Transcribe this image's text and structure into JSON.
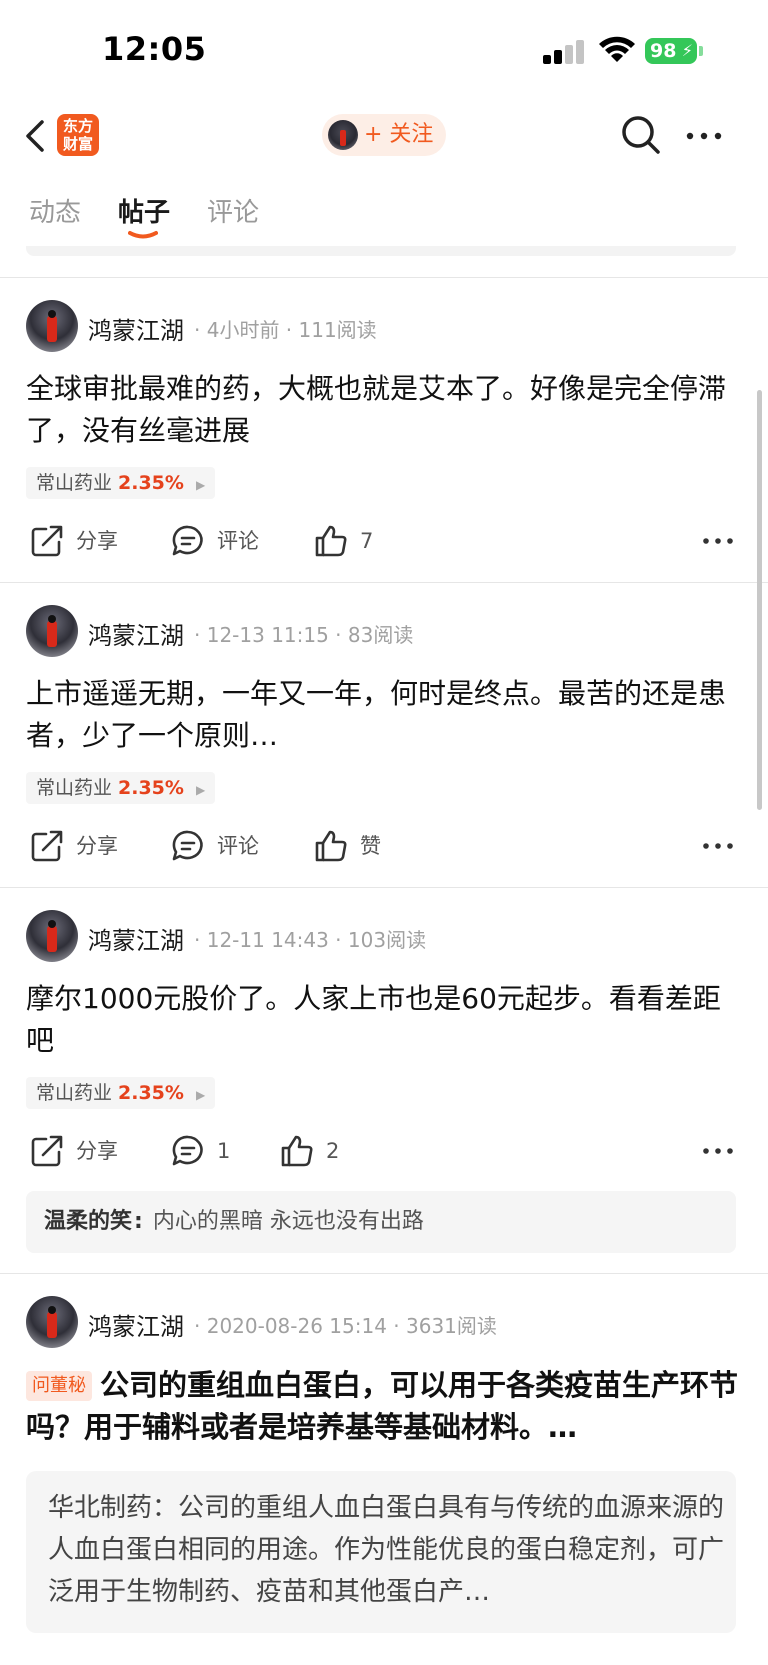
{
  "status_bar": {
    "time": "12:05",
    "battery": "98"
  },
  "nav": {
    "logo_line1": "东方",
    "logo_line2": "财富",
    "follow_label": "+ 关注"
  },
  "tabs": [
    {
      "label": "动态"
    },
    {
      "label": "帖子"
    },
    {
      "label": "评论"
    }
  ],
  "posts": [
    {
      "author": "鸿蒙江湖",
      "meta": "· 4小时前 · 111阅读",
      "text": "全球审批最难的药，大概也就是艾本了。好像是完全停滞了，没有丝毫进展",
      "stock_name": "常山药业",
      "stock_pct": "2.35%",
      "share_label": "分享",
      "comment_label": "评论",
      "like_label": "7"
    },
    {
      "author": "鸿蒙江湖",
      "meta": "· 12-13 11:15 · 83阅读",
      "text": "上市遥遥无期，一年又一年，何时是终点。最苦的还是患者，少了一个原则…",
      "stock_name": "常山药业",
      "stock_pct": "2.35%",
      "share_label": "分享",
      "comment_label": "评论",
      "like_label": "赞"
    },
    {
      "author": "鸿蒙江湖",
      "meta": "· 12-11 14:43 · 103阅读",
      "text": "摩尔1000元股价了。人家上市也是60元起步。看看差距吧",
      "stock_name": "常山药业",
      "stock_pct": "2.35%",
      "share_label": "分享",
      "comment_label": "1",
      "like_label": "2",
      "reply_user": "温柔的笑",
      "reply_text": "内心的黑暗 永远也没有出路"
    },
    {
      "author": "鸿蒙江湖",
      "meta": "· 2020-08-26 15:14 · 3631阅读",
      "badge": "问董秘",
      "title": "公司的重组血白蛋白，可以用于各类疫苗生产环节吗？用于辅料或者是培养基等基础材料。…",
      "answer": "华北制药：公司的重组人血白蛋白具有与传统的血源来源的人血白蛋白相同的用途。作为性能优良的蛋白稳定剂，可广泛用于生物制药、疫苗和其他蛋白产…"
    }
  ],
  "colors": {
    "accent": "#f15a1f",
    "rise": "#e5421c",
    "battery": "#34c759"
  },
  "icons": [
    "back-icon",
    "search-icon",
    "more-icon",
    "share-icon",
    "comment-icon",
    "like-icon"
  ]
}
